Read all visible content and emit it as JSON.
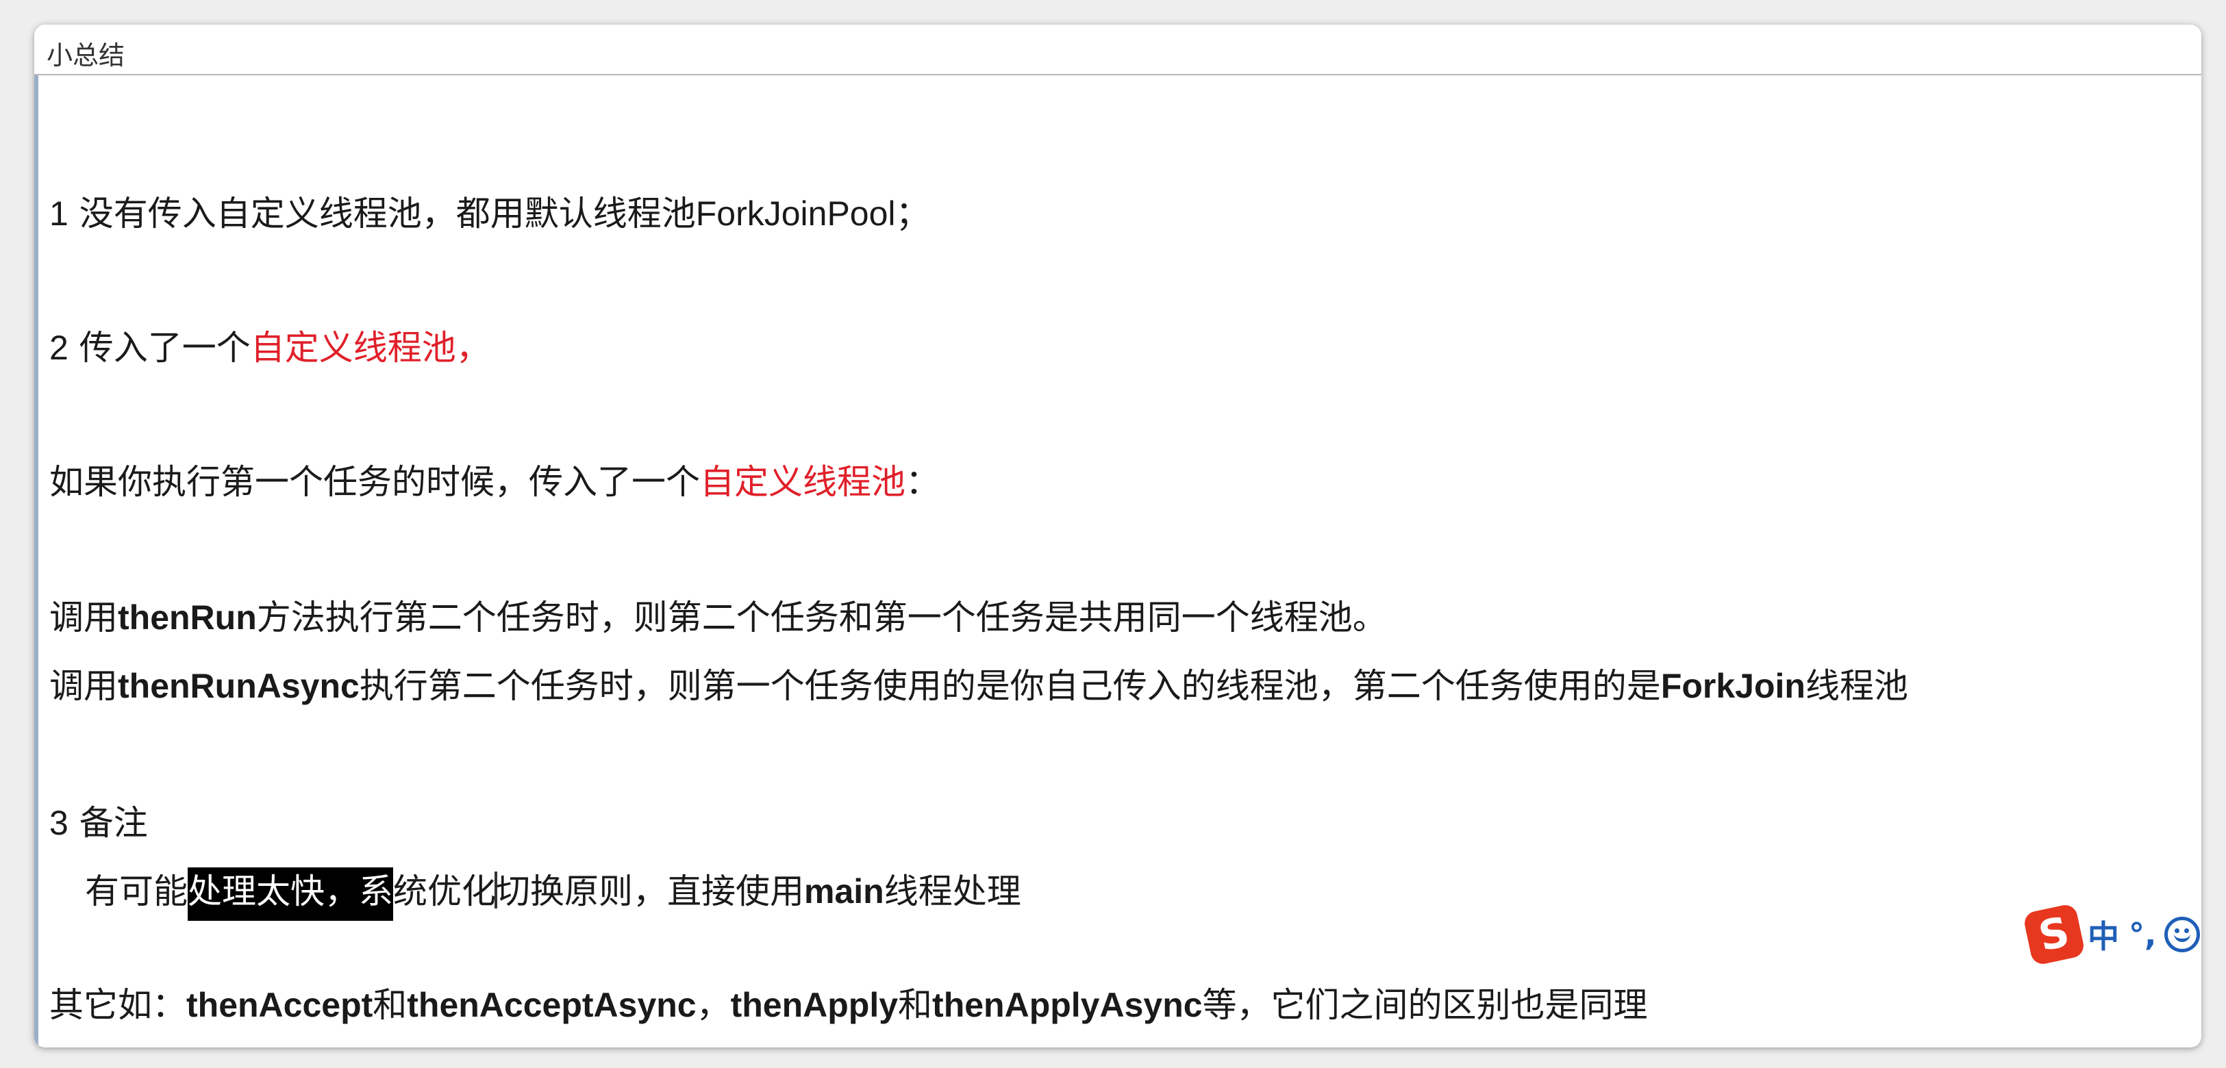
{
  "window": {
    "title": "小总结"
  },
  "summary": {
    "item1": {
      "number": "1",
      "text_a": "没有传入自定义线程池，都用默认线程池",
      "text_code": "ForkJoinPool",
      "text_b": "；"
    },
    "item2": {
      "number": "2",
      "text_a": "传入了一个",
      "text_red": "自定义线程池，"
    },
    "condition": {
      "text_a": "如果你执行第一个任务的时候，传入了一个",
      "text_red": "自定义线程池",
      "text_b": "："
    },
    "thenrun_line": {
      "prefix": "调用",
      "method": "thenRun",
      "rest": "方法执行第二个任务时，则第二个任务和第一个任务是共用同一个线程池。"
    },
    "thenrunasync_line": {
      "prefix": "调用",
      "method": "thenRunAsync",
      "middle": "执行第二个任务时，则第一个任务使用的是你自己传入的线程池，第二个任务使用的是",
      "pool": "ForkJoin",
      "suffix": "线程池"
    },
    "item3": {
      "number": "3",
      "text": "备注"
    },
    "note": {
      "before": "有可能",
      "highlighted": "处理太快，系",
      "middle_a": "统优化",
      "middle_b": "切换原则，直接使用",
      "code": "main",
      "after": "线程处理"
    },
    "others": {
      "prefix": "其它如：",
      "m1": "thenAccept",
      "and1": "和",
      "m2": "thenAcceptAsync",
      "sep": "，",
      "m3": "thenApply",
      "and2": "和",
      "m4": "thenApplyAsync",
      "suffix": "等，它们之间的区别也是同理"
    }
  },
  "ime_toolbar": {
    "logo": "S",
    "mode": "中",
    "punct": "°,",
    "emoji_icon": "smiley-icon",
    "accent_color": "#e8371f",
    "text_color": "#1f5fb8"
  },
  "colors": {
    "emphasis_red": "#e0202a",
    "selection_bg": "#000000"
  }
}
